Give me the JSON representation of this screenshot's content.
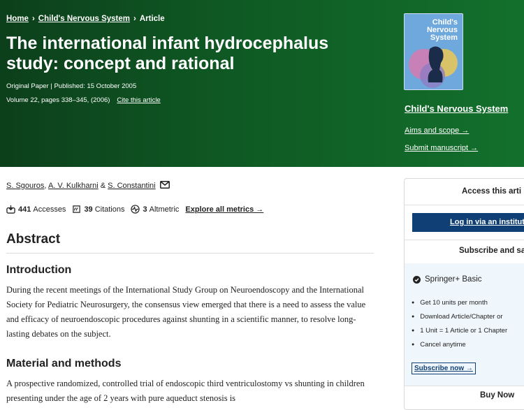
{
  "breadcrumbs": [
    "Home",
    "Child's Nervous System",
    "Article"
  ],
  "breadcrumb_sep": "›",
  "article": {
    "title": "The international infant hydrocephalus study: concept and rational",
    "type_published": "Original Paper  |  Published: 15 October 2005",
    "volume": "Volume 22, pages 338–345, (2006)",
    "cite_label": "Cite this article"
  },
  "journal": {
    "cover_title": "Child's Nervous System",
    "name": "Child's Nervous System",
    "aims_label": "Aims and scope →",
    "submit_label": "Submit manuscript →"
  },
  "authors": {
    "a1": "S. Sgouros",
    "sep1": ", ",
    "a2": "A. V. Kulkharni",
    "sep2": " & ",
    "a3": "S. Constantini"
  },
  "metrics": {
    "accesses_count": "441",
    "accesses_label": "Accesses",
    "citations_count": "39",
    "citations_label": "Citations",
    "altmetric_count": "3",
    "altmetric_label": "Altmetric",
    "explore_label": "Explore all metrics →"
  },
  "abstract": {
    "heading": "Abstract",
    "intro_heading": "Introduction",
    "intro_text": "During the recent meetings of the International Study Group on Neuroendoscopy and the International Society for Pediatric Neurosurgery, the consensus view emerged that there is a need to assess the value and efficacy of neuroendoscopic procedures against shunting in a scientific manner, to resolve long-lasting debates on the subject.",
    "methods_heading": "Material and methods",
    "methods_text": "A prospective randomized, controlled trial of endoscopic third ventriculostomy vs shunting in children presenting under the age of 2 years with pure aqueduct stenosis is"
  },
  "access_panel": {
    "access_title": "Access this arti",
    "login_label": "Log in via an institut",
    "subscribe_title": "Subscribe and sa",
    "plan_name": "Springer+ Basic",
    "bullets": [
      "Get 10 units per month",
      "Download Article/Chapter or",
      "1 Unit = 1 Article or 1 Chapter",
      "Cancel anytime"
    ],
    "subscribe_now": "Subscribe now →",
    "buy_now": "Buy Now"
  },
  "colors": {
    "hero_dark": "#0c3f1b",
    "hero_light": "#13702c",
    "login_button": "#0f3f75",
    "plan_bg": "#f0f7fc"
  }
}
